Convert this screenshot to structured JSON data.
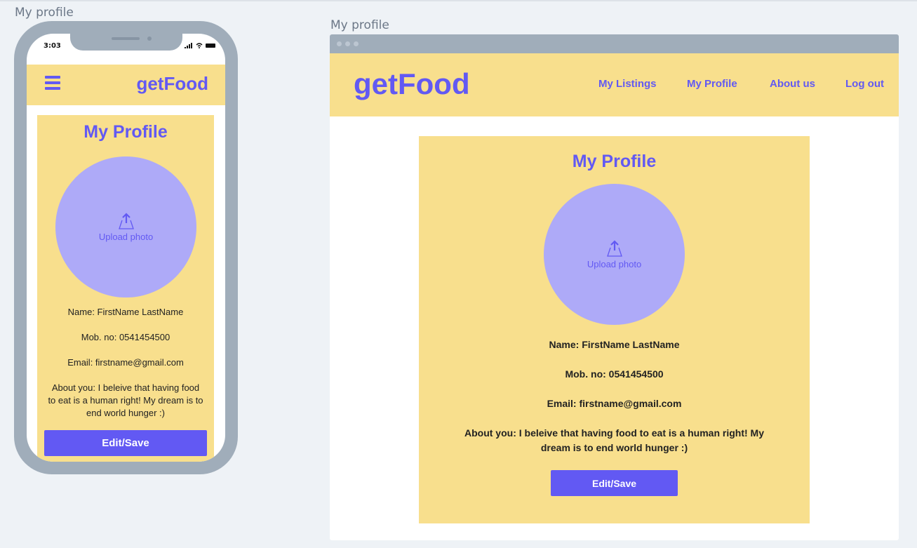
{
  "phone_frame": {
    "label": "My profile",
    "status_time": "3:03",
    "header": {
      "logo": "getFood",
      "menu_icon": "hamburger-icon"
    },
    "card": {
      "title": "My Profile",
      "upload_label": "Upload photo",
      "name": "Name: FirstName LastName",
      "mobile": "Mob. no: 0541454500",
      "email": "Email: firstname@gmail.com",
      "about": "About you: I beleive that having food to eat is a human right! My dream is to end world hunger :)",
      "button_label": "Edit/Save"
    }
  },
  "desktop_frame": {
    "label": "My profile",
    "header": {
      "logo": "getFood",
      "nav": [
        "My Listings",
        "My Profile",
        "About us",
        "Log out"
      ]
    },
    "card": {
      "title": "My Profile",
      "upload_label": "Upload photo",
      "name": "Name: FirstName LastName",
      "mobile": "Mob. no: 0541454500",
      "email": "Email: firstname@gmail.com",
      "about": "About you: I beleive that having food to eat is a human right! My dream is to end world hunger :)",
      "button_label": "Edit/Save"
    }
  },
  "colors": {
    "accent": "#6259f3",
    "header_bg": "#f8df8d",
    "avatar_bg": "#aeaaf8",
    "frame_gray": "#a0adba",
    "canvas_bg": "#eef2f6"
  }
}
